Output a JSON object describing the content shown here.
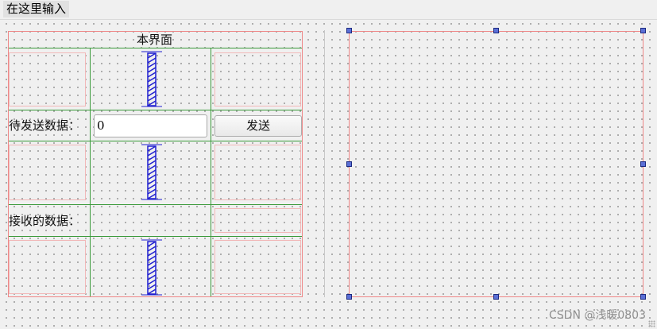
{
  "menubar": {
    "placeholder_item": "在这里输入"
  },
  "form": {
    "title": "本界面",
    "send_label": "待发送数据：",
    "send_input_value": "0",
    "send_button": "发送",
    "receive_label": "接收的数据："
  },
  "colors": {
    "layout_border": "#e88888",
    "grid_line": "#3a9a3a",
    "spacer": "#1f1fd0",
    "selection_handle": "#5b6fd6"
  },
  "icons": [
    "vertical-spacer-icon",
    "selection-handle-icon"
  ],
  "watermark": "CSDN @浅暖0803"
}
